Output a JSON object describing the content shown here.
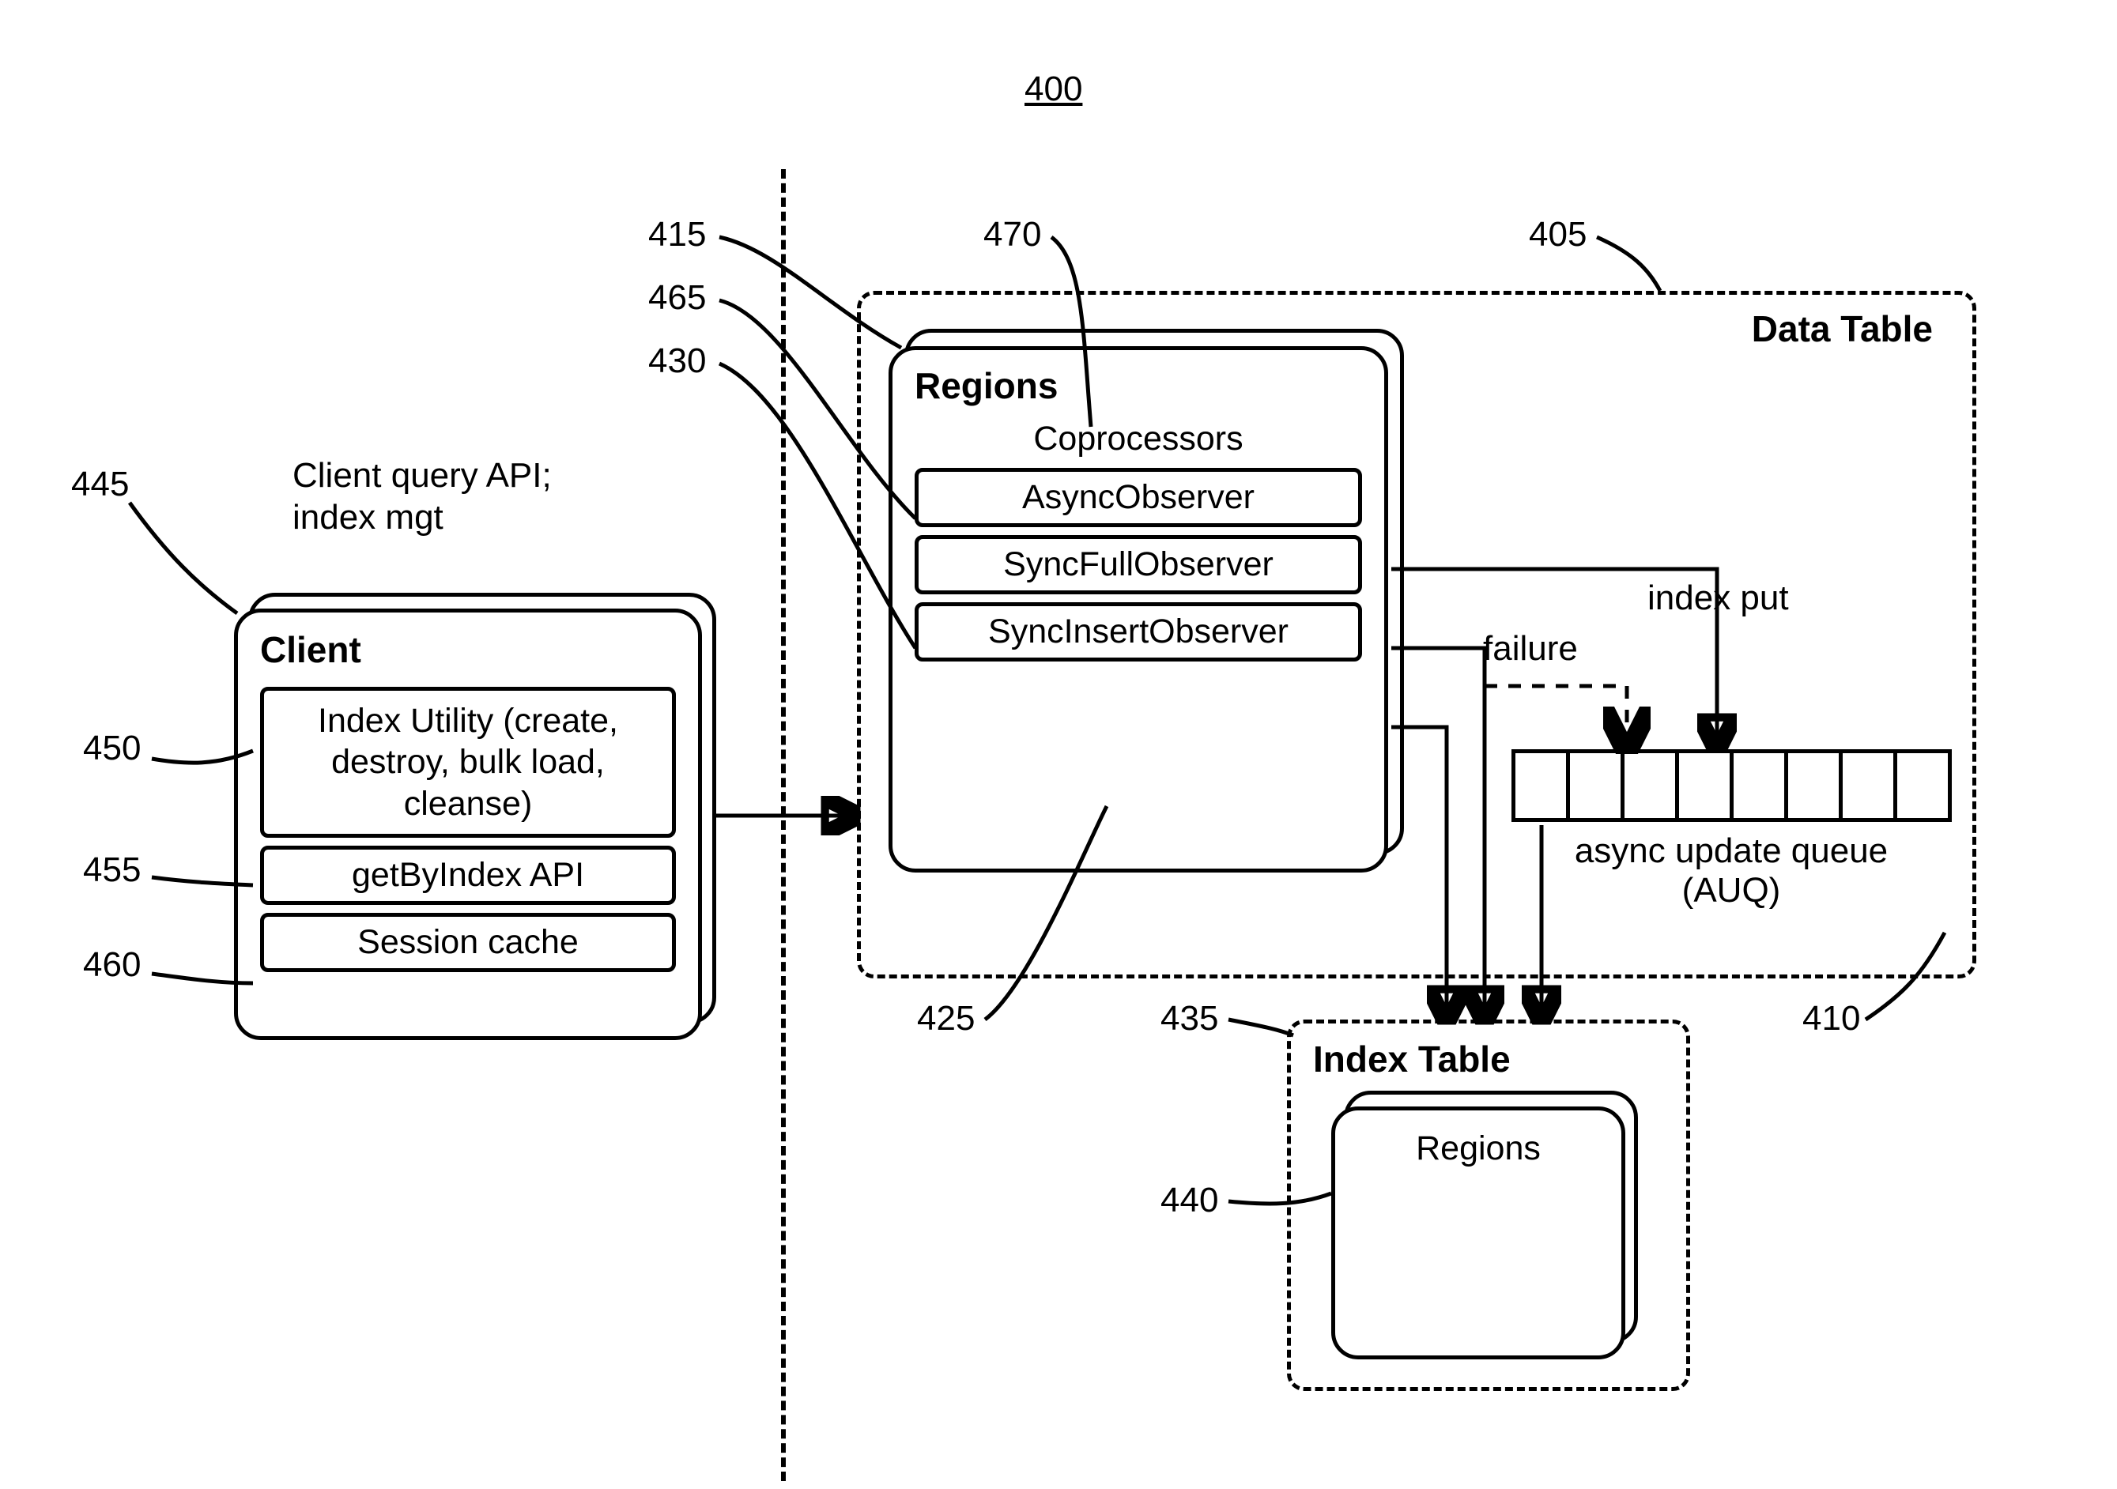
{
  "figure_number": "400",
  "client_api_caption": "Client query API;\nindex mgt",
  "client": {
    "title": "Client",
    "index_utility": "Index Utility (create, destroy, bulk load, cleanse)",
    "get_by_index": "getByIndex API",
    "session_cache": "Session cache"
  },
  "data_table": {
    "title": "Data Table",
    "regions": {
      "title": "Regions",
      "coprocessors_label": "Coprocessors",
      "items": [
        "AsyncObserver",
        "SyncFullObserver",
        "SyncInsertObserver"
      ]
    },
    "edge_index_put": "index put",
    "edge_failure": "failure",
    "auq_label": "async update queue (AUQ)"
  },
  "index_table": {
    "title": "Index Table",
    "regions": "Regions"
  },
  "refs": {
    "r400": "400",
    "r405": "405",
    "r410": "410",
    "r415": "415",
    "r425": "425",
    "r430": "430",
    "r435": "435",
    "r440": "440",
    "r445": "445",
    "r450": "450",
    "r455": "455",
    "r460": "460",
    "r465": "465",
    "r470": "470"
  }
}
